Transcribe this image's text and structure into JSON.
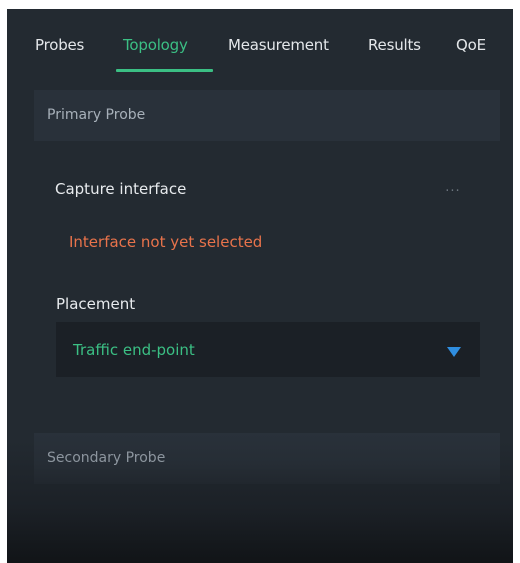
{
  "tabs": [
    {
      "label": "Probes",
      "active": false
    },
    {
      "label": "Topology",
      "active": true
    },
    {
      "label": "Measurement",
      "active": false
    },
    {
      "label": "Results",
      "active": false
    },
    {
      "label": "QoE",
      "active": false
    }
  ],
  "primary_probe": {
    "header": "Primary Probe",
    "capture_interface_label": "Capture interface",
    "more_icon": "ellipsis-icon",
    "more_glyph": "...",
    "interface_status": "Interface not yet selected",
    "placement_label": "Placement",
    "placement_value": "Traffic end-point",
    "dropdown_icon": "triangle-down-icon"
  },
  "secondary_probe": {
    "header": "Secondary Probe"
  },
  "colors": {
    "accent_green": "#3bbf84",
    "warning_orange": "#e8734b",
    "dropdown_blue": "#2f8ee0",
    "panel_bg": "#232a31",
    "section_bg": "#29313a"
  }
}
